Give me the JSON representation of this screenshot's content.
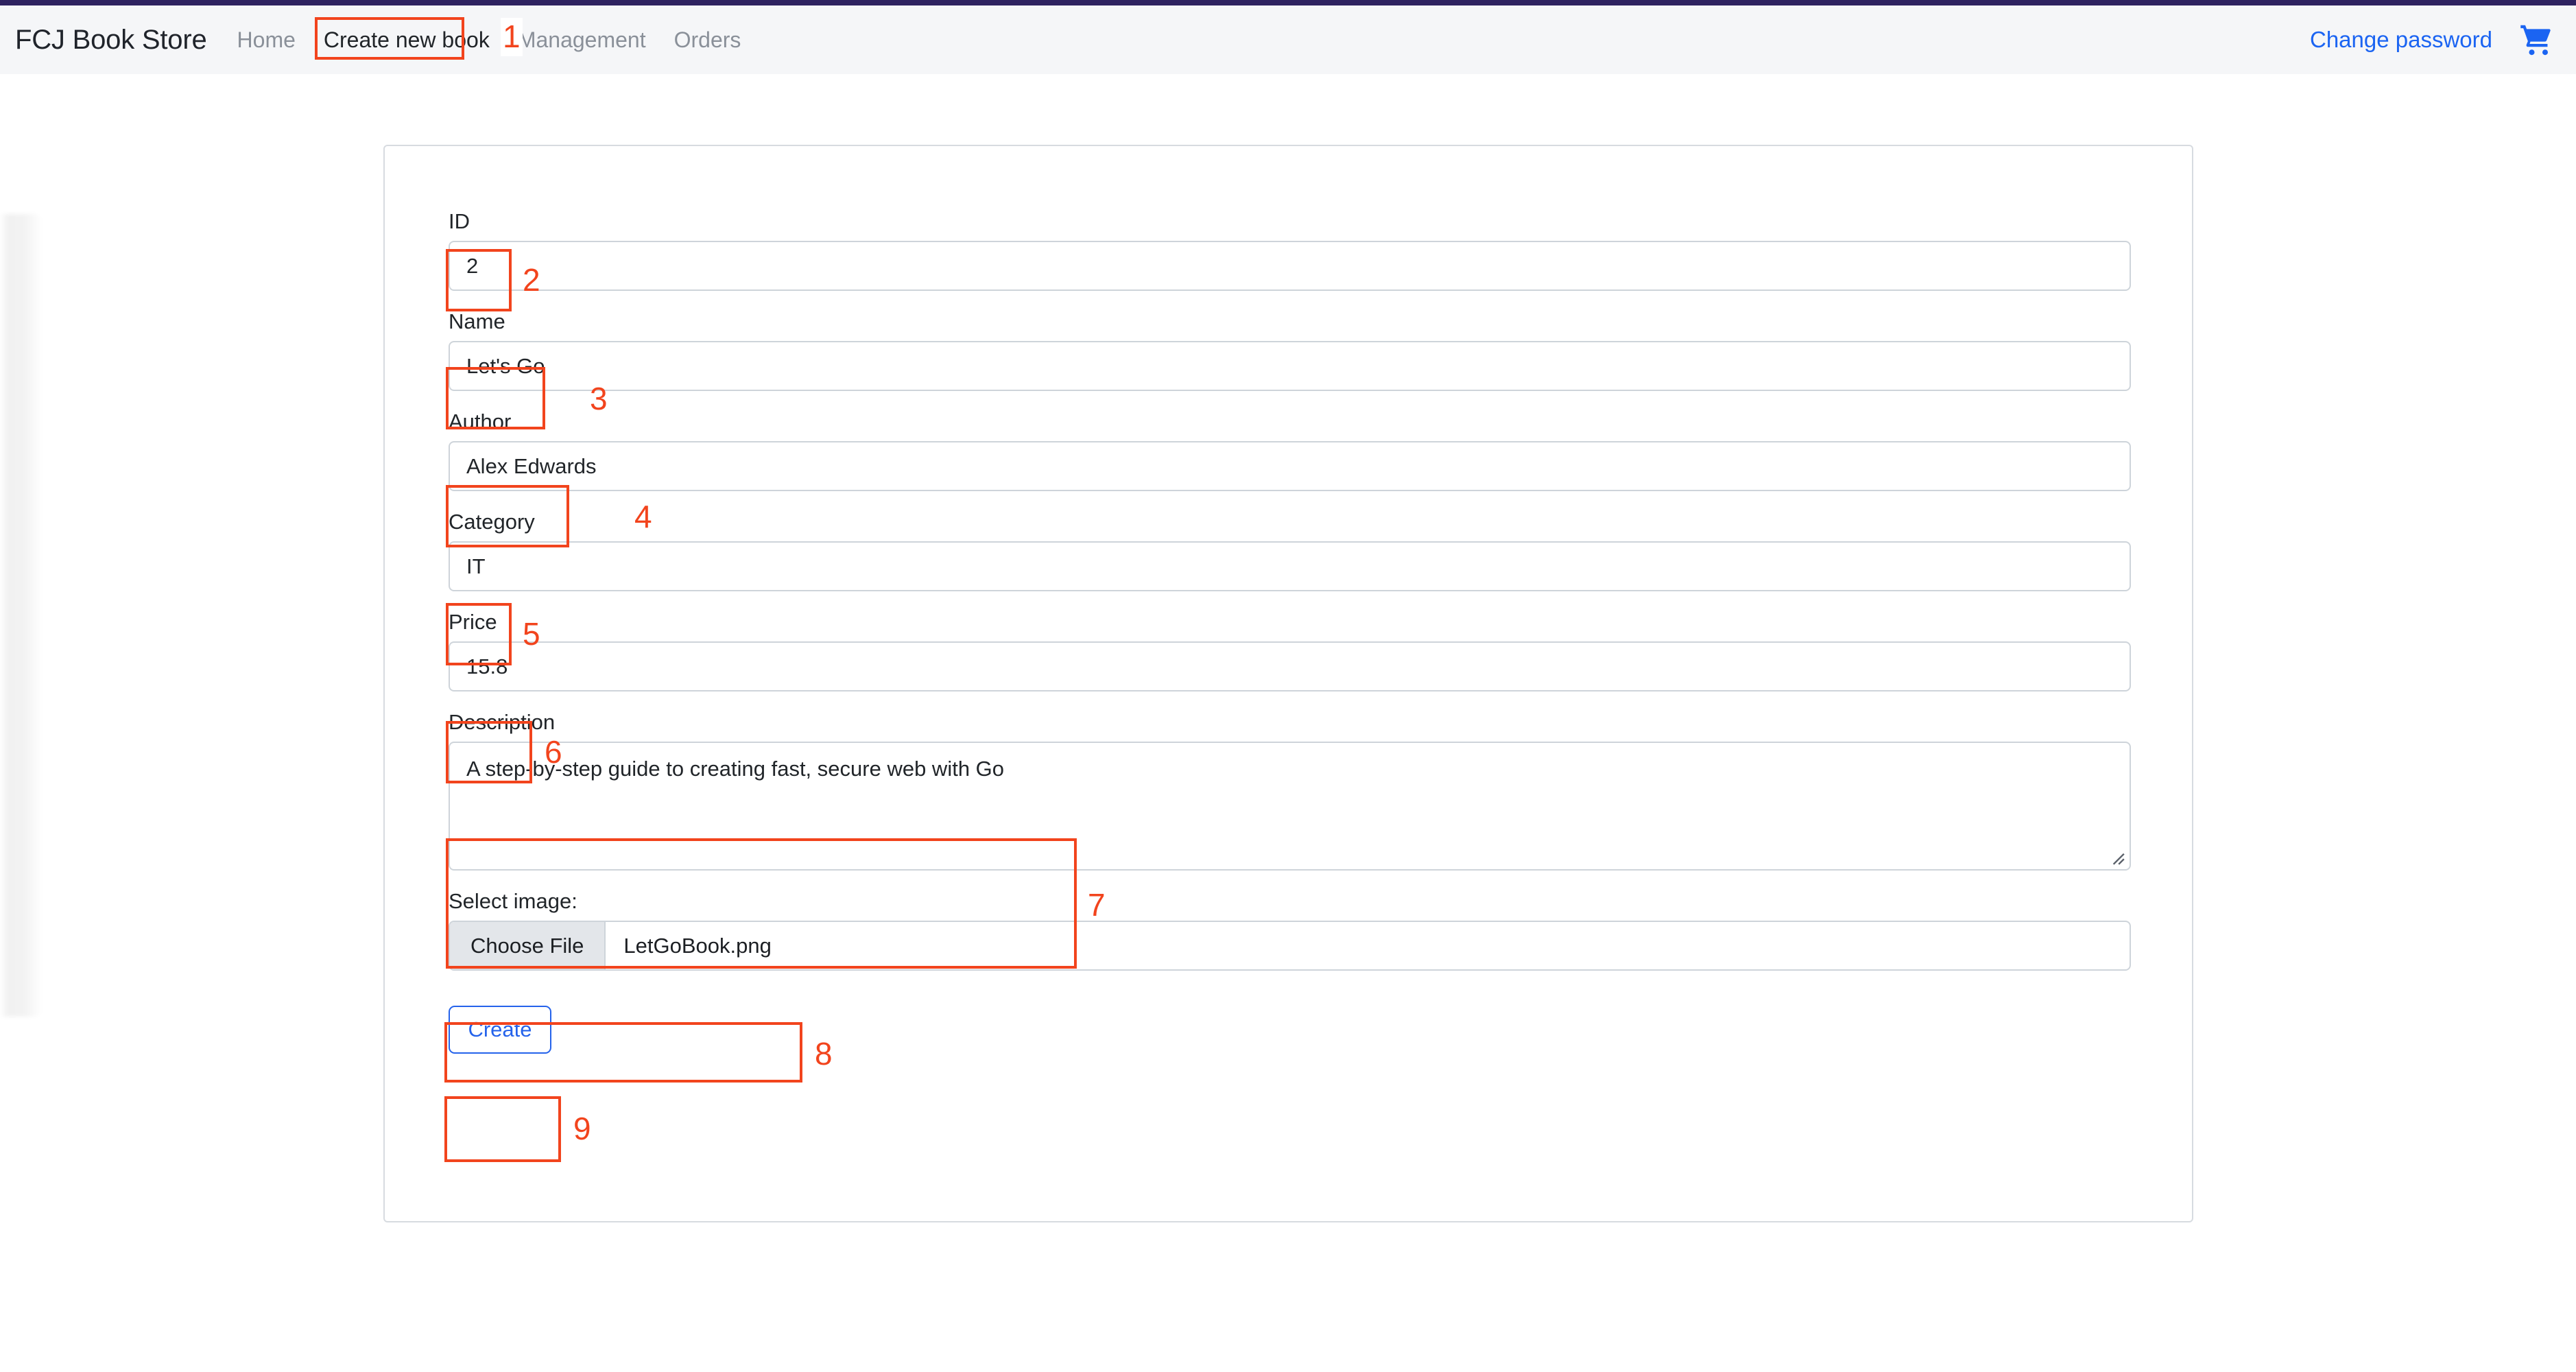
{
  "navbar": {
    "brand": "FCJ Book Store",
    "links": [
      {
        "label": "Home",
        "active": false
      },
      {
        "label": "Create new book",
        "active": true
      },
      {
        "label": "Management",
        "active": false
      },
      {
        "label": "Orders",
        "active": false
      }
    ],
    "change_password": "Change password",
    "cart_icon": "shopping-cart-icon",
    "link_color": "#1b64f2",
    "accent_strip_color": "#2e2260",
    "background": "#f5f6f8"
  },
  "form": {
    "fields": [
      {
        "label": "ID",
        "value": "2"
      },
      {
        "label": "Name",
        "value": "Let's Go"
      },
      {
        "label": "Author",
        "value": "Alex Edwards"
      },
      {
        "label": "Category",
        "value": "IT"
      },
      {
        "label": "Price",
        "value": "15.8"
      }
    ],
    "description": {
      "label": "Description",
      "value": "A step-by-step guide to creating fast, secure web with Go"
    },
    "file": {
      "label": "Select image:",
      "button_label": "Choose File",
      "file_name": "LetGoBook.png"
    },
    "submit": {
      "label": "Create",
      "color": "#2563eb"
    }
  },
  "annotations": {
    "color": "#f2441d",
    "markers": [
      {
        "n": "1",
        "target": "nav-create-new-book"
      },
      {
        "n": "2",
        "target": "id-input"
      },
      {
        "n": "3",
        "target": "name-input"
      },
      {
        "n": "4",
        "target": "author-input"
      },
      {
        "n": "5",
        "target": "category-input"
      },
      {
        "n": "6",
        "target": "price-input"
      },
      {
        "n": "7",
        "target": "description-textarea"
      },
      {
        "n": "8",
        "target": "file-input"
      },
      {
        "n": "9",
        "target": "create-button"
      }
    ]
  }
}
